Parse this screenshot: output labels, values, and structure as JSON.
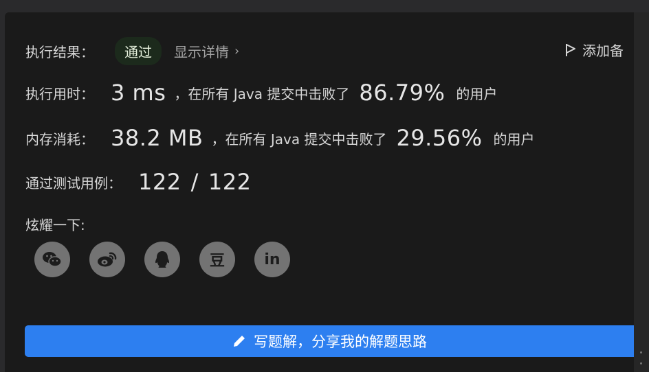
{
  "result": {
    "label": "执行结果：",
    "status": "通过",
    "details_link": "显示详情",
    "add_note": "添加备"
  },
  "runtime": {
    "label": "执行用时：",
    "value": "3 ms",
    "prefix": "，在所有 Java 提交中击败了",
    "percent": "86.79%",
    "suffix": "的用户"
  },
  "memory": {
    "label": "内存消耗：",
    "value": "38.2 MB",
    "prefix": "，在所有 Java 提交中击败了",
    "percent": "29.56%",
    "suffix": "的用户"
  },
  "tests": {
    "label": "通过测试用例：",
    "passed": "122",
    "separator": "/",
    "total": "122"
  },
  "share": {
    "label": "炫耀一下:",
    "buttons": [
      {
        "name": "wechat-icon"
      },
      {
        "name": "weibo-icon"
      },
      {
        "name": "qq-icon"
      },
      {
        "name": "douban-icon",
        "glyph": "豆"
      },
      {
        "name": "linkedin-icon",
        "glyph": "in"
      }
    ]
  },
  "write_solution": {
    "label": "写题解，分享我的解题思路",
    "icon": "pencil-icon"
  },
  "colors": {
    "panel_bg": "#1a1a1a",
    "accent": "#2d7ff0",
    "status_bg": "#1c2a1c",
    "icon_circle": "#737373"
  }
}
